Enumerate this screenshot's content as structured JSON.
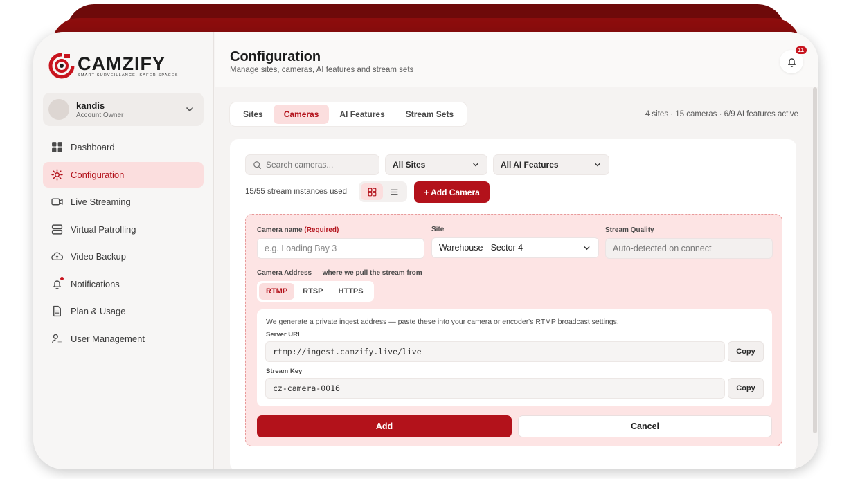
{
  "brand": {
    "name": "CAMZIFY",
    "tagline": "SMART SURVEILLANCE, SAFER SPACES",
    "accent": "#b3121b"
  },
  "account": {
    "name": "kandis",
    "role": "Account Owner"
  },
  "sidebar": {
    "items": [
      {
        "label": "Dashboard",
        "icon": "grid-icon"
      },
      {
        "label": "Configuration",
        "icon": "gear-icon",
        "active": true
      },
      {
        "label": "Live Streaming",
        "icon": "video-camera-icon"
      },
      {
        "label": "Virtual Patrolling",
        "icon": "server-icon"
      },
      {
        "label": "Video Backup",
        "icon": "cloud-upload-icon"
      },
      {
        "label": "Notifications",
        "icon": "bell-icon"
      },
      {
        "label": "Plan & Usage",
        "icon": "document-icon"
      },
      {
        "label": "User Management",
        "icon": "users-icon"
      }
    ]
  },
  "header": {
    "title": "Configuration",
    "subtitle": "Manage sites, cameras, AI features and stream sets",
    "notification_count": "11"
  },
  "tabs": [
    {
      "label": "Sites"
    },
    {
      "label": "Cameras",
      "active": true
    },
    {
      "label": "AI Features"
    },
    {
      "label": "Stream Sets"
    }
  ],
  "stats": "4 sites · 15 cameras · 6/9 AI features active",
  "toolbar": {
    "search_placeholder": "Search cameras...",
    "sites_filter": "All Sites",
    "ai_filter": "All AI Features",
    "usage": "15/55 stream instances used",
    "add_camera": "+ Add Camera"
  },
  "form": {
    "camera_name_label": "Camera name",
    "required": "(Required)",
    "camera_name_placeholder": "e.g. Loading Bay 3",
    "site_label": "Site",
    "site_value": "Warehouse - Sector 4",
    "quality_label": "Stream Quality",
    "quality_value": "Auto-detected on connect",
    "address_label": "Camera Address — where we pull the stream from",
    "protocols": [
      "RTMP",
      "RTSP",
      "HTTPS"
    ],
    "active_protocol": "RTMP",
    "note": "We generate a private ingest address — paste these into your camera or encoder's RTMP broadcast settings.",
    "server_url_label": "Server URL",
    "server_url": "rtmp://ingest.camzify.live/live",
    "stream_key_label": "Stream Key",
    "stream_key": "cz-camera-0016",
    "copy_label": "Copy",
    "add_label": "Add",
    "cancel_label": "Cancel"
  }
}
